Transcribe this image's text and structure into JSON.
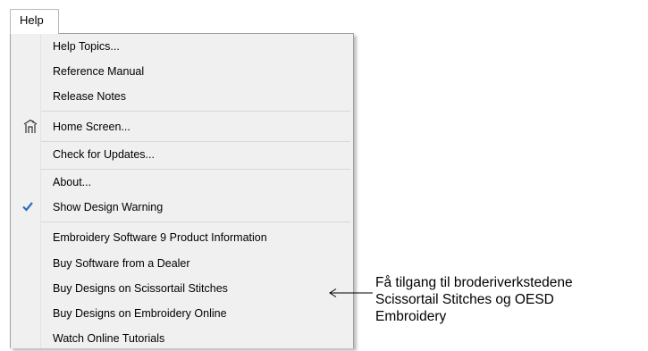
{
  "menubar": {
    "help_label": "Help"
  },
  "menu": {
    "items": [
      {
        "label": "Help Topics..."
      },
      {
        "label": "Reference Manual"
      },
      {
        "label": "Release Notes"
      },
      {
        "label": "Home Screen...",
        "icon": "home-screen-icon"
      },
      {
        "label": "Check for Updates..."
      },
      {
        "label": "About..."
      },
      {
        "label": "Show Design Warning",
        "checked": true,
        "icon": "checkmark-icon"
      },
      {
        "label": "Embroidery Software 9 Product Information"
      },
      {
        "label": "Buy Software from a Dealer"
      },
      {
        "label": "Buy Designs on Scissortail Stitches"
      },
      {
        "label": "Buy Designs on Embroidery Online"
      },
      {
        "label": "Watch Online Tutorials"
      }
    ]
  },
  "annotation": {
    "lines": [
      "Få tilgang til broderiverkstedene",
      "Scissortail Stitches og OESD",
      "Embroidery"
    ]
  },
  "colors": {
    "menu_bg": "#f0f0f0",
    "check": "#2a6ebb"
  }
}
